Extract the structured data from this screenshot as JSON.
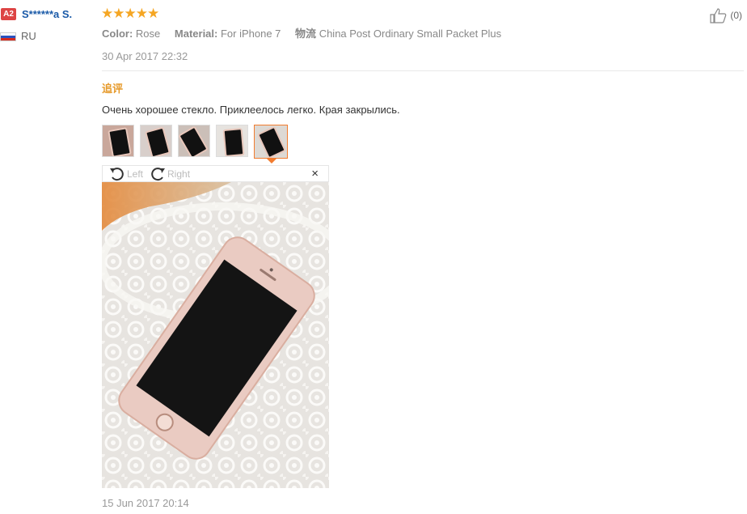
{
  "reviewer": {
    "badge": "A2",
    "name": "S******a S.",
    "country": "RU"
  },
  "review": {
    "stars": "★★★★★",
    "attributes": [
      {
        "key": "Color:",
        "value": "Rose"
      },
      {
        "key": "Material:",
        "value": "For iPhone 7"
      },
      {
        "key": "物流",
        "value": "China Post Ordinary Small Packet Plus"
      }
    ],
    "date": "30 Apr 2017 22:32",
    "likes": "(0)"
  },
  "followup": {
    "heading": "追评",
    "comment": "Очень хорошее стекло. Приклеелось легко. Края закрылись.",
    "date": "15 Jun 2017 20:14",
    "thumbnail_count": 5,
    "active_thumbnail": 5
  },
  "viewer": {
    "rotate_left": "Left",
    "rotate_right": "Right",
    "close": "×"
  },
  "colors": {
    "accent_orange": "#f27c2f",
    "star": "#f5a623",
    "followup_heading": "#e69a2b",
    "username": "#1a5aa8"
  }
}
